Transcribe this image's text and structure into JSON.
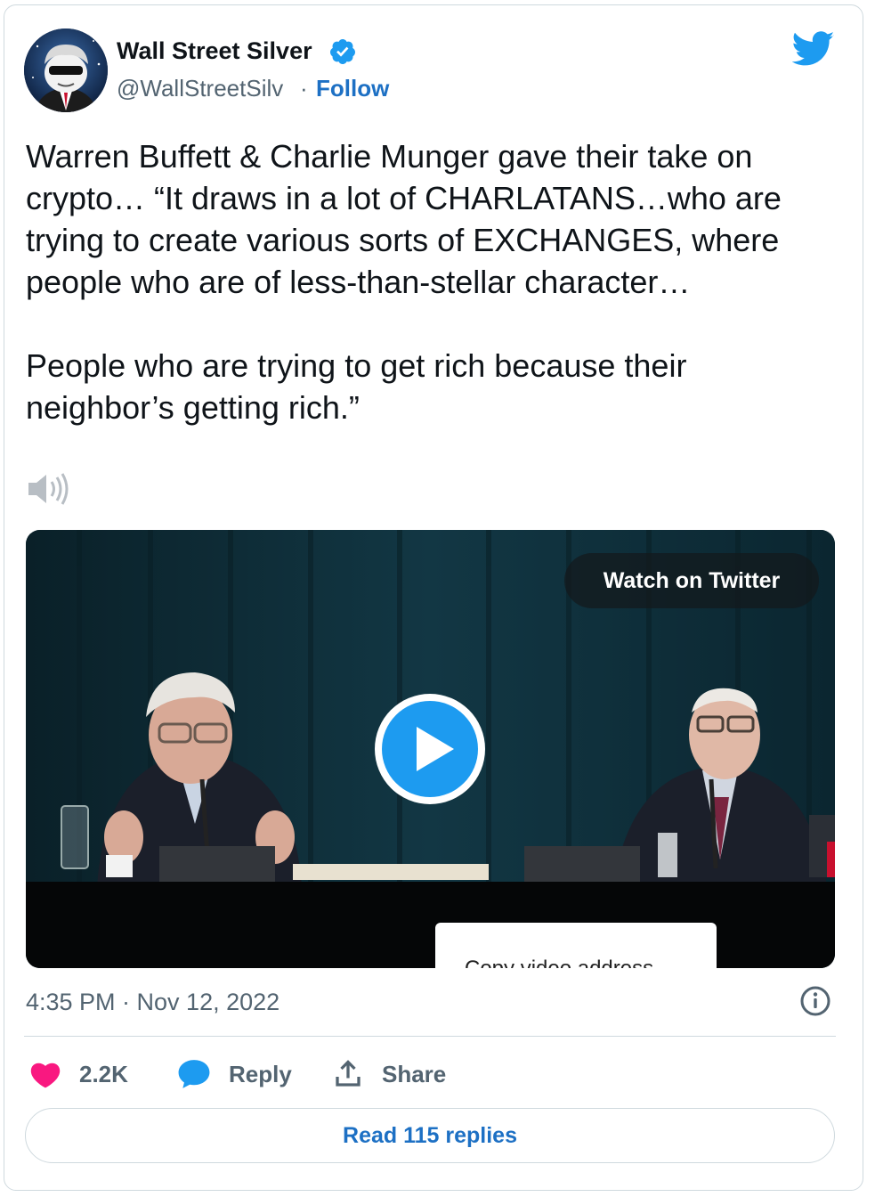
{
  "author": {
    "name": "Wall Street Silver",
    "handle": "@WallStreetSilv",
    "separator": "·",
    "follow_label": "Follow"
  },
  "tweet": {
    "text": "Warren Buffett & Charlie Munger gave their take on crypto… “It draws in a lot of CHARLATANS…who are trying to create various sorts of EXCHANGES, where people who are of less-than-stellar character…\n\nPeople who are trying to get rich because their neighbor’s getting rich.”"
  },
  "media": {
    "watch_label": "Watch on Twitter",
    "context_menu_item": "Copy video address"
  },
  "meta": {
    "timestamp": "4:35 PM · Nov 12, 2022"
  },
  "actions": {
    "like_count": "2.2K",
    "reply_label": "Reply",
    "share_label": "Share"
  },
  "read_replies_label": "Read 115 replies",
  "colors": {
    "link_blue": "#1d70c4",
    "twitter_blue": "#1d9bf0",
    "like_pink": "#f91880",
    "verified_blue": "#1d9bf0",
    "muted_text": "#536471"
  },
  "icons": [
    "verified-badge-icon",
    "twitter-bird-icon",
    "speaker-icon",
    "play-icon",
    "info-icon",
    "heart-icon",
    "reply-bubble-icon",
    "share-icon"
  ]
}
